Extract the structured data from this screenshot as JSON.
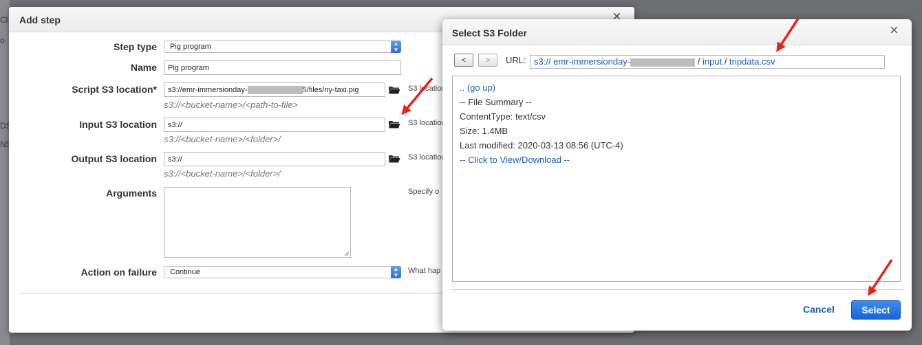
{
  "background": {
    "fragments": [
      "Cl",
      "o",
      "DS",
      "N5"
    ]
  },
  "add_step": {
    "title": "Add step",
    "close_icon": "×",
    "step_type": {
      "label": "Step type",
      "value": "Pig program"
    },
    "name": {
      "label": "Name",
      "value": "Pig program"
    },
    "script": {
      "label": "Script S3 location*",
      "value_prefix": "s3://emr-immersionday-",
      "value_suffix": "5/files/ny-taxi.pig",
      "hint": "s3://<bucket-name>/<path-to-file>",
      "side": "S3 location"
    },
    "input": {
      "label": "Input S3 location",
      "value": "s3://",
      "hint": "s3://<bucket-name>/<folder>/",
      "side": "S3 location"
    },
    "output": {
      "label": "Output S3 location",
      "value": "s3://",
      "hint": "s3://<bucket-name>/<folder>/",
      "side": "S3 location"
    },
    "arguments": {
      "label": "Arguments",
      "side": "Specify o"
    },
    "action_on_failure": {
      "label": "Action on failure",
      "value": "Continue",
      "side": "What hap"
    }
  },
  "s3_dialog": {
    "title": "Select S3 Folder",
    "close_icon": "×",
    "back_button": "<",
    "forward_button": ">",
    "url_label": "URL:",
    "url": {
      "bucket_prefix": "s3:// emr-immersionday-",
      "sep1": " / ",
      "folder": "input",
      "sep2": " / ",
      "file": "tripdata.csv"
    },
    "browser": {
      "go_up": ".. (go up)",
      "summary": "-- File Summary --",
      "content_type": "ContentType: text/csv",
      "size": "Size: 1.4MB",
      "last_modified": "Last modified: 2020-03-13 08:56 (UTC-4)",
      "view_download": "-- Click to View/Download --"
    },
    "cancel_label": "Cancel",
    "select_label": "Select"
  },
  "colors": {
    "link": "#1a5fb4",
    "primary_button": "#1665d8",
    "annotation_arrow": "#e8221b"
  },
  "icons": [
    "folder-icon",
    "close-icon",
    "chevron-updown-icon",
    "resize-grip-icon",
    "arrow-annotation"
  ]
}
